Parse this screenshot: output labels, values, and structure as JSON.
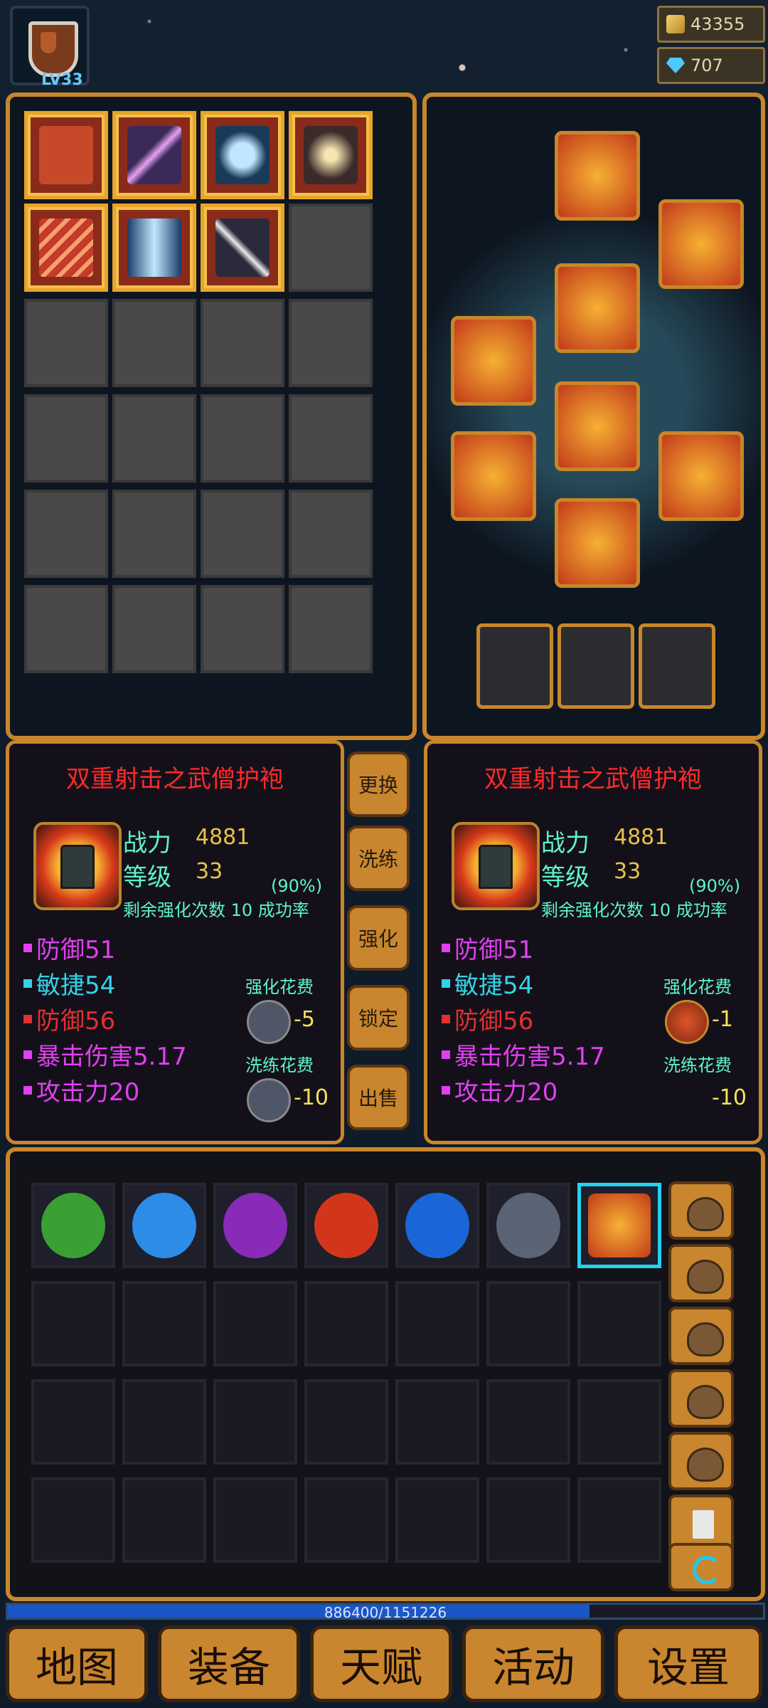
{
  "player": {
    "level": "LV33"
  },
  "currency": {
    "gold": "43355",
    "gems": "707"
  },
  "detail_left": {
    "title": "双重射击之武僧护袍",
    "power_label": "战力",
    "power_value": "4881",
    "level_label": "等级",
    "level_value": "33",
    "rate": "(90%)",
    "remaining_label": "剩余强化次数 10 成功率",
    "attrs": [
      {
        "text": "防御51",
        "color": "#e040f0"
      },
      {
        "text": "敏捷54",
        "color": "#34d2e8"
      },
      {
        "text": "防御56",
        "color": "#e23030"
      },
      {
        "text": "暴击伤害5.17",
        "color": "#e040f0"
      },
      {
        "text": "攻击力20",
        "color": "#e040f0"
      }
    ],
    "enhance_cost_label": "强化花费",
    "enhance_cost_value": "-5",
    "reforge_cost_label": "洗练花费",
    "reforge_cost_value": "-10"
  },
  "detail_right": {
    "title": "双重射击之武僧护袍",
    "power_label": "战力",
    "power_value": "4881",
    "level_label": "等级",
    "level_value": "33",
    "rate": "(90%)",
    "remaining_label": "剩余强化次数 10 成功率",
    "attrs": [
      {
        "text": "防御51",
        "color": "#e040f0"
      },
      {
        "text": "敏捷54",
        "color": "#34d2e8"
      },
      {
        "text": "防御56",
        "color": "#e23030"
      },
      {
        "text": "暴击伤害5.17",
        "color": "#e040f0"
      },
      {
        "text": "攻击力20",
        "color": "#e040f0"
      }
    ],
    "enhance_cost_label": "强化花费",
    "enhance_cost_value": "-1",
    "reforge_cost_label": "洗练花费",
    "reforge_cost_value": "-10"
  },
  "actions": {
    "replace": "更换",
    "reforge": "洗练",
    "enhance": "强化",
    "lock": "锁定",
    "sell": "出售"
  },
  "exp": {
    "text": "886400/1151226",
    "progress": 0.77
  },
  "nav": {
    "map": "地图",
    "equip": "装备",
    "talent": "天赋",
    "activity": "活动",
    "settings": "设置"
  },
  "colors": {
    "frame": "#c8862a",
    "title_red": "#ff2a2a",
    "stat_cyan": "#5ef5c8",
    "value_gold": "#e8c24a"
  }
}
